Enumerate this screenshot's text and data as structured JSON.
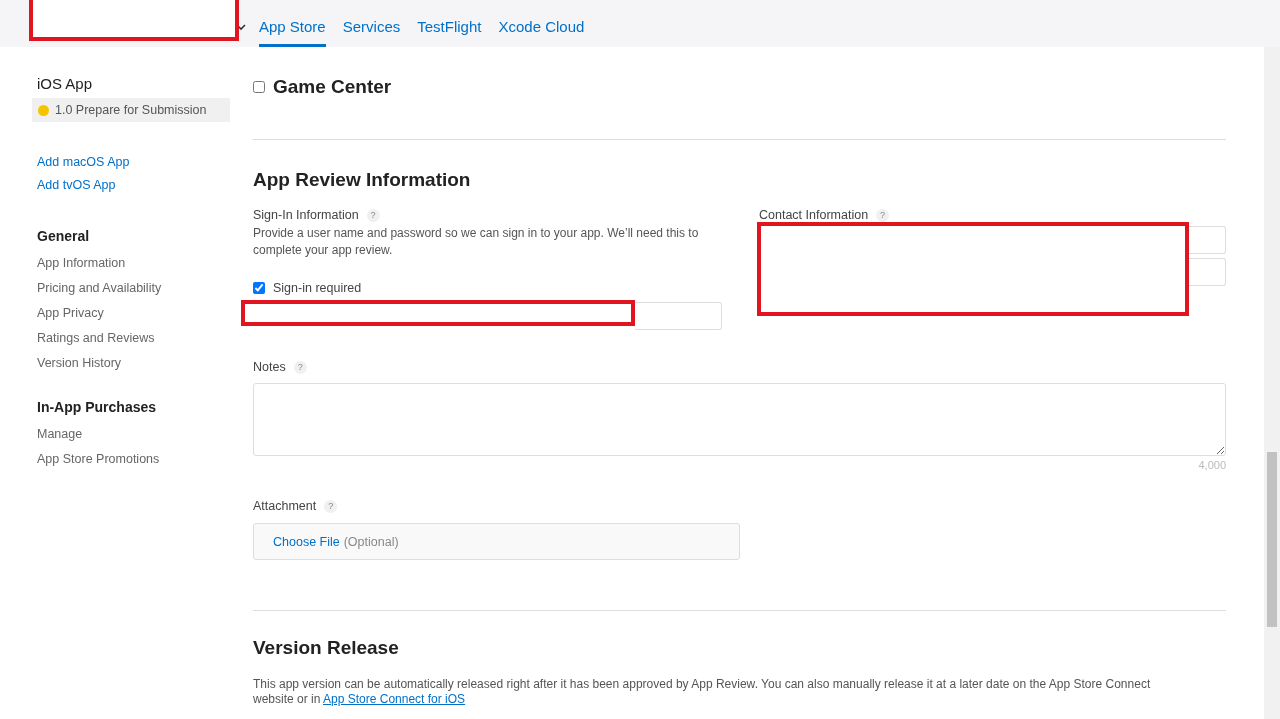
{
  "header": {
    "tabs": [
      {
        "label": "App Store",
        "selected": true
      },
      {
        "label": "Services",
        "selected": false
      },
      {
        "label": "TestFlight",
        "selected": false
      },
      {
        "label": "Xcode Cloud",
        "selected": false
      }
    ]
  },
  "sidebar": {
    "platform_title": "iOS App",
    "version": {
      "label": "1.0 Prepare for Submission",
      "color": "#f5c400",
      "selected": true
    },
    "add_links": [
      "Add macOS App",
      "Add tvOS App"
    ],
    "sections": [
      {
        "title": "General",
        "items": [
          "App Information",
          "Pricing and Availability",
          "App Privacy",
          "Ratings and Reviews",
          "Version History"
        ]
      },
      {
        "title": "In-App Purchases",
        "items": [
          "Manage",
          "App Store Promotions"
        ]
      }
    ]
  },
  "game_center": {
    "label": "Game Center",
    "checked": false
  },
  "app_review": {
    "title": "App Review Information",
    "sign_in": {
      "label": "Sign-In Information",
      "help": "?",
      "description": "Provide a user name and password so we can sign in to your app. We’ll need this to complete your app review.",
      "required_label": "Sign-in required",
      "required_checked": true
    },
    "contact": {
      "label": "Contact Information",
      "help": "?"
    },
    "notes": {
      "label": "Notes",
      "help": "?",
      "counter": "4,000"
    },
    "attachment": {
      "label": "Attachment",
      "help": "?",
      "button": "Choose File",
      "hint": "(Optional)"
    }
  },
  "version_release": {
    "title": "Version Release",
    "description": "This app version can be automatically released right after it has been approved by App Review. You can also manually release it at a later date on the App Store Connect website or in",
    "link": "App Store Connect for iOS"
  }
}
